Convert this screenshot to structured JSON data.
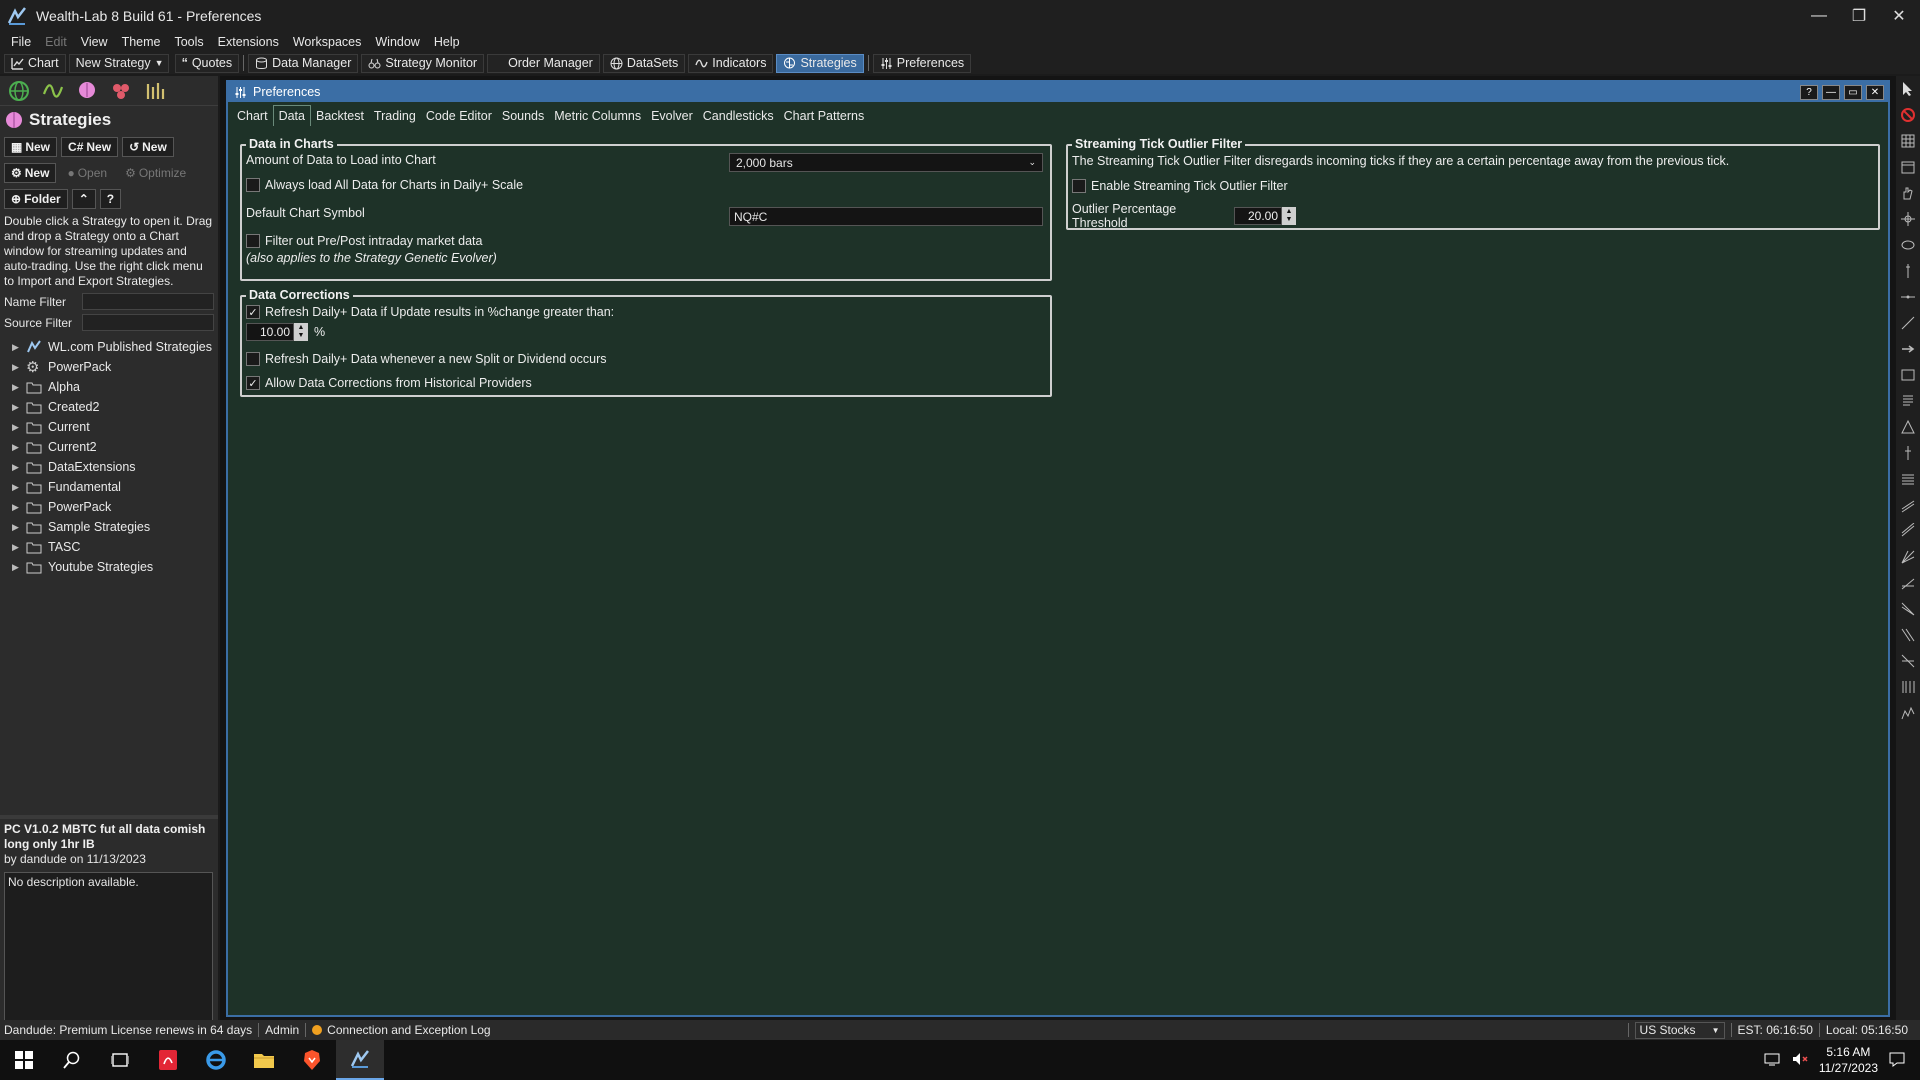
{
  "window": {
    "title": "Wealth-Lab 8 Build 61 - Preferences"
  },
  "menu": [
    "File",
    "Edit",
    "View",
    "Theme",
    "Tools",
    "Extensions",
    "Workspaces",
    "Window",
    "Help"
  ],
  "toolbar": {
    "chart": "Chart",
    "new_strategy": "New Strategy",
    "quotes": "Quotes",
    "data_manager": "Data Manager",
    "strategy_monitor": "Strategy Monitor",
    "order_manager": "Order Manager",
    "datasets": "DataSets",
    "indicators": "Indicators",
    "strategies": "Strategies",
    "preferences": "Preferences"
  },
  "left": {
    "title": "Strategies",
    "new1": "New",
    "new2": "New",
    "new3": "New",
    "new4": "New",
    "open": "Open",
    "optimize": "Optimize",
    "folder": "Folder",
    "help_btn": "?",
    "help_text": "Double click a Strategy to open it. Drag and drop a Strategy onto a Chart window for streaming updates and auto-trading. Use the right click menu to Import and Export Strategies.",
    "name_filter": "Name Filter",
    "source_filter": "Source Filter",
    "tree": [
      "WL.com Published Strategies",
      "PowerPack",
      "Alpha",
      "Created2",
      "Current",
      "Current2",
      "DataExtensions",
      "Fundamental",
      "PowerPack",
      "Sample Strategies",
      "TASC",
      "Youtube Strategies"
    ],
    "strategy_name": "PC V1.0.2 MBTC fut all data comish long only 1hr IB",
    "strategy_by": "by dandude on 11/13/2023",
    "description": "No description available."
  },
  "prefs": {
    "title": "Preferences",
    "tabs": [
      "Chart",
      "Data",
      "Backtest",
      "Trading",
      "Code Editor",
      "Sounds",
      "Metric Columns",
      "Evolver",
      "Candlesticks",
      "Chart Patterns"
    ],
    "active_tab": "Data",
    "data_in_charts": {
      "title": "Data in Charts",
      "amount_label": "Amount of Data to Load into Chart",
      "amount_value": "2,000 bars",
      "always_load": "Always load All Data for Charts in Daily+ Scale",
      "always_load_checked": false,
      "default_symbol_label": "Default Chart Symbol",
      "default_symbol_value": "NQ#C",
      "filter_prepost": "Filter out Pre/Post intraday market data",
      "filter_prepost_checked": false,
      "filter_note": "(also applies to the Strategy Genetic Evolver)"
    },
    "data_corrections": {
      "title": "Data Corrections",
      "refresh_pct": "Refresh Daily+ Data if Update results in %change greater than:",
      "refresh_pct_checked": true,
      "pct_value": "10.00",
      "pct_unit": "%",
      "refresh_split": "Refresh Daily+ Data whenever a new Split or Dividend occurs",
      "refresh_split_checked": false,
      "allow_corrections": "Allow Data Corrections from Historical Providers",
      "allow_corrections_checked": true
    },
    "streaming": {
      "title": "Streaming Tick Outlier Filter",
      "desc": "The Streaming Tick Outlier Filter disregards incoming ticks if they are a certain percentage away from the previous tick.",
      "enable": "Enable Streaming Tick Outlier Filter",
      "enable_checked": false,
      "threshold_label": "Outlier Percentage Threshold",
      "threshold_value": "20.00"
    }
  },
  "status": {
    "license": "Dandude: Premium License renews in 64 days",
    "admin": "Admin",
    "log": "Connection and Exception Log",
    "market": "US Stocks",
    "est": "EST: 06:16:50",
    "local": "Local: 05:16:50"
  },
  "taskbar": {
    "time": "5:16 AM",
    "date": "11/27/2023"
  }
}
